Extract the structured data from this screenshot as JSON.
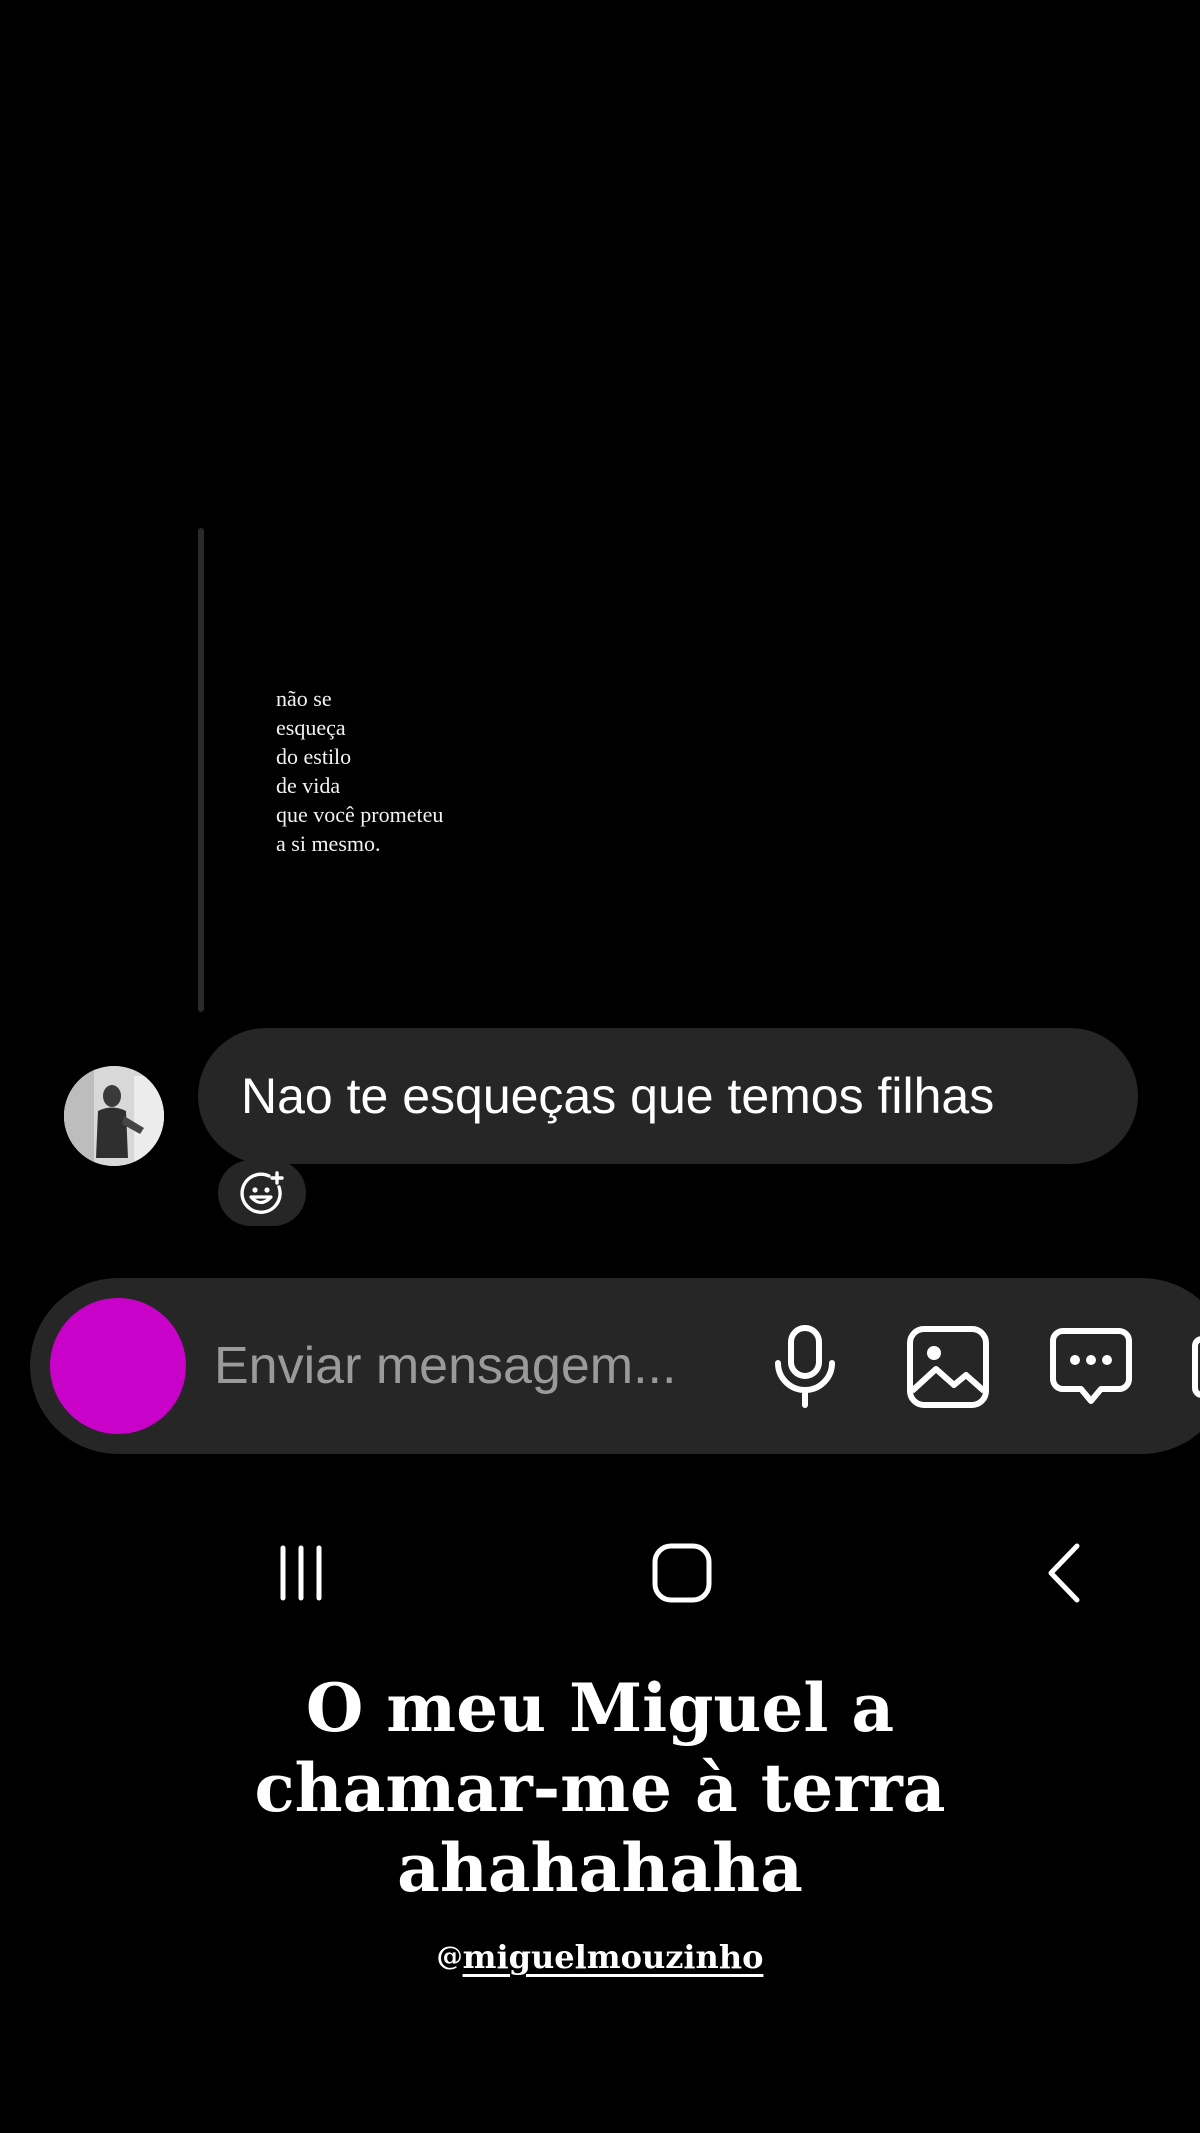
{
  "chat": {
    "quoted_story_lines": [
      "não se",
      "esqueça",
      "do estilo",
      "de vida",
      "que você prometeu",
      "a si mesmo."
    ],
    "message": "Nao te esqueças que temos filhas"
  },
  "composer": {
    "placeholder": "Enviar mensagem...",
    "camera_color": "#c902c9",
    "icons": [
      "microphone-icon",
      "image-icon",
      "chat-bubble-icon"
    ]
  },
  "nav": {
    "icons": [
      "recent-apps-icon",
      "home-icon",
      "back-icon"
    ]
  },
  "story_caption": {
    "lines": [
      "O meu Miguel a",
      "chamar-me à terra",
      "ahahahaha"
    ],
    "mention": "miguelmouzinho",
    "mention_glyph": "@"
  }
}
